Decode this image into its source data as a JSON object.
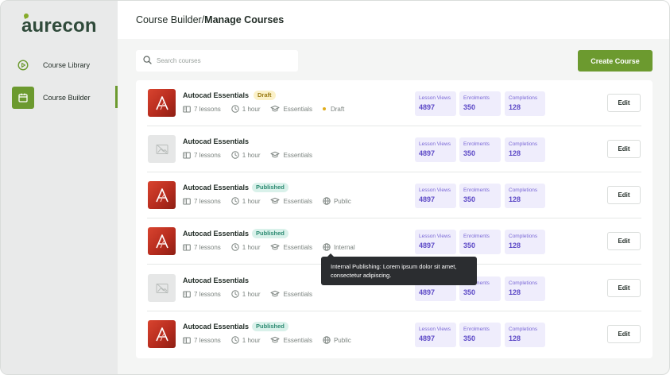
{
  "brand": {
    "logo_text": "aurecon",
    "accent": "#6c9a2f"
  },
  "sidebar": {
    "items": [
      {
        "label": "Course Library",
        "icon": "play-circle-icon",
        "active": false
      },
      {
        "label": "Course Builder",
        "icon": "calendar-icon",
        "active": true
      }
    ]
  },
  "header": {
    "breadcrumb_root": "Course Builder",
    "breadcrumb_sep": "/",
    "breadcrumb_current": "Manage Courses"
  },
  "search": {
    "placeholder": "Search courses",
    "icon": "search-icon"
  },
  "toolbar": {
    "create_label": "Create Course"
  },
  "courses": [
    {
      "title": "Autocad Essentials",
      "badge": "Draft",
      "lessons": "7 lessons",
      "duration": "1 hour",
      "level": "Essentials",
      "status": "Draft",
      "thumb": "autocad",
      "views_label": "Lesson Views",
      "views": "4897",
      "enrol_label": "Enrolments",
      "enrol": "350",
      "comp_label": "Completions",
      "comp": "128",
      "edit_label": "Edit"
    },
    {
      "title": "Autocad Essentials",
      "badge": "",
      "lessons": "7 lessons",
      "duration": "1 hour",
      "level": "Essentials",
      "status": "",
      "thumb": "placeholder",
      "views_label": "Lesson Views",
      "views": "4897",
      "enrol_label": "Enrolments",
      "enrol": "350",
      "comp_label": "Completions",
      "comp": "128",
      "edit_label": "Edit"
    },
    {
      "title": "Autocad Essentials",
      "badge": "Published",
      "lessons": "7 lessons",
      "duration": "1 hour",
      "level": "Essentials",
      "status": "Public",
      "thumb": "autocad",
      "views_label": "Lesson Views",
      "views": "4897",
      "enrol_label": "Enrolments",
      "enrol": "350",
      "comp_label": "Completions",
      "comp": "128",
      "edit_label": "Edit"
    },
    {
      "title": "Autocad Essentials",
      "badge": "Published",
      "lessons": "7 lessons",
      "duration": "1 hour",
      "level": "Essentials",
      "status": "Internal",
      "thumb": "autocad",
      "views_label": "Lesson Views",
      "views": "4897",
      "enrol_label": "Enrolments",
      "enrol": "350",
      "comp_label": "Completions",
      "comp": "128",
      "edit_label": "Edit"
    },
    {
      "title": "Autocad Essentials",
      "badge": "",
      "lessons": "7 lessons",
      "duration": "1 hour",
      "level": "Essentials",
      "status": "",
      "thumb": "placeholder",
      "views_label": "Lesson Views",
      "views": "4897",
      "enrol_label": "Enrolments",
      "enrol": "350",
      "comp_label": "Completions",
      "comp": "128",
      "edit_label": "Edit"
    },
    {
      "title": "Autocad Essentials",
      "badge": "Published",
      "lessons": "7 lessons",
      "duration": "1 hour",
      "level": "Essentials",
      "status": "Public",
      "thumb": "autocad",
      "views_label": "Lesson Views",
      "views": "4897",
      "enrol_label": "Enrolments",
      "enrol": "350",
      "comp_label": "Completions",
      "comp": "128",
      "edit_label": "Edit"
    }
  ],
  "tooltip": {
    "text": "Internal Publishing: Lorem ipsum dolor sit amet, consectetur adipiscing."
  }
}
